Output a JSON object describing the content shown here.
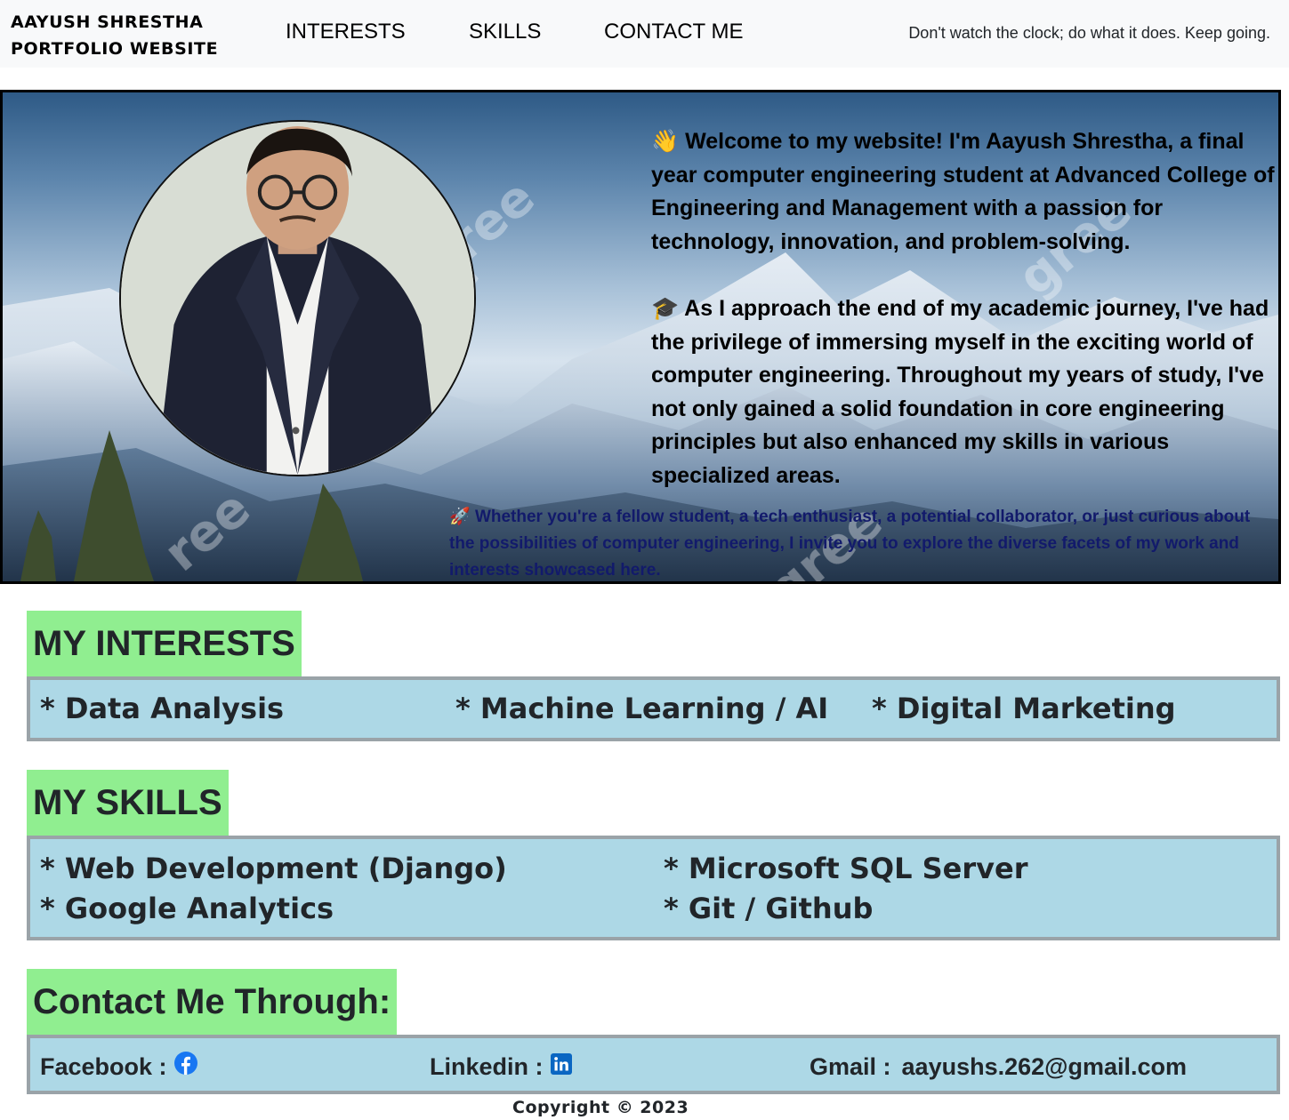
{
  "navbar": {
    "brand_line1": "AAYUSH SHRESTHA",
    "brand_line2": "PORTFOLIO WEBSITE",
    "links": [
      "INTERESTS",
      "SKILLS",
      "CONTACT ME"
    ],
    "quote": "Don't watch the clock; do what it does. Keep going."
  },
  "hero": {
    "emoji_wave": "👋",
    "welcome": "Welcome to my website! I'm Aayush Shrestha, a final year computer engineering student at Advanced College of Engineering and Management with a passion for technology, innovation, and problem-solving.",
    "emoji_grad": "🎓",
    "journey": "As I approach the end of my academic journey, I've had the privilege of immersing myself in the exciting world of computer engineering. Throughout my years of study, I've not only gained a solid foundation in core engineering principles but also enhanced my skills in various specialized areas.",
    "emoji_rocket": "🚀",
    "invite": "Whether you're a fellow student, a tech enthusiast, a potential collaborator, or just curious about the possibilities of computer engineering, I invite you to explore the diverse facets of my work and interests showcased here.",
    "watermark": "vecteezy"
  },
  "interests": {
    "title": "MY INTERESTS",
    "items": [
      "* Data Analysis",
      "* Machine Learning / AI",
      "* Digital Marketing"
    ]
  },
  "skills": {
    "title": "MY SKILLS",
    "items": [
      "* Web Development (Django)",
      "* Microsoft SQL Server",
      "* Google Analytics",
      "* Git / Github"
    ]
  },
  "contact": {
    "title": "Contact Me Through:",
    "facebook_label": "Facebook :",
    "linkedin_label": "Linkedin :",
    "gmail_label": "Gmail :",
    "gmail_value": "aayushs.262@gmail.com",
    "icons": [
      "facebook-icon",
      "linkedin-icon"
    ]
  },
  "footer": {
    "copyright": "Copyright © 2023"
  },
  "colors": {
    "section_title_bg": "#90ee90",
    "box_bg": "#add8e6",
    "navbar_bg": "#f8f9fa",
    "invite_text": "#121a6b",
    "icon_blue": "#1877f2",
    "linkedin_blue": "#0a66c2"
  }
}
